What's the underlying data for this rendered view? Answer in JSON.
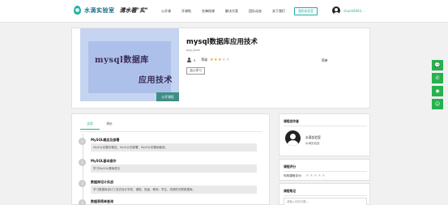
{
  "header": {
    "logo_text": "水滴实验室",
    "slogan": "清水著\"实\"",
    "nav": [
      "公开课",
      "开课啦",
      "先锋授课",
      "解决方案",
      "团队动态",
      "关于我们"
    ],
    "register_label": "我的实验室",
    "user_name": "shuidi4693..."
  },
  "course": {
    "cover_line1": "mysql数据库",
    "cover_line2": "应用技术",
    "cover_badge": "公开课程",
    "title": "mysql数据库应用技术",
    "author": "ang_learn",
    "learners": "5",
    "rating_label": "等级",
    "rating_stars": [
      true,
      true,
      true,
      false,
      false
    ],
    "difficulty": "简单",
    "join_label": "加入学习"
  },
  "side_icons": [
    "chat-icon",
    "phone-icon",
    "wechat-icon",
    "qq-icon"
  ],
  "content": {
    "tabs": [
      "实验",
      "评价"
    ],
    "lessons": [
      {
        "num": "1",
        "title": "MySQL概念及部署",
        "desc": "MySQL的基本概念、MySQL的部署、MySQL的基础使用。"
      },
      {
        "num": "2",
        "title": "MySQL基本操作",
        "desc": "学习MySQL基础语法"
      },
      {
        "num": "3",
        "title": "数据库设计实战",
        "desc": "学习数据库设计三范式设计学校、课程、班级、教师、学生、成绩的关联数据库。"
      },
      {
        "num": "4",
        "title": "数据表简单查询",
        "desc": ""
      }
    ]
  },
  "sidebar": {
    "author_box_title": "课程创作者",
    "author_name": "水滴实验室",
    "author_role": "水滴实验室",
    "rating_box_title": "课程评分",
    "rating_row_label": "你的课程评分：",
    "rating_row_stars": [
      false,
      false,
      false,
      false,
      false
    ],
    "notes_box_title": "课程笔记",
    "notes_placeholder": "请输入你的问题..."
  }
}
